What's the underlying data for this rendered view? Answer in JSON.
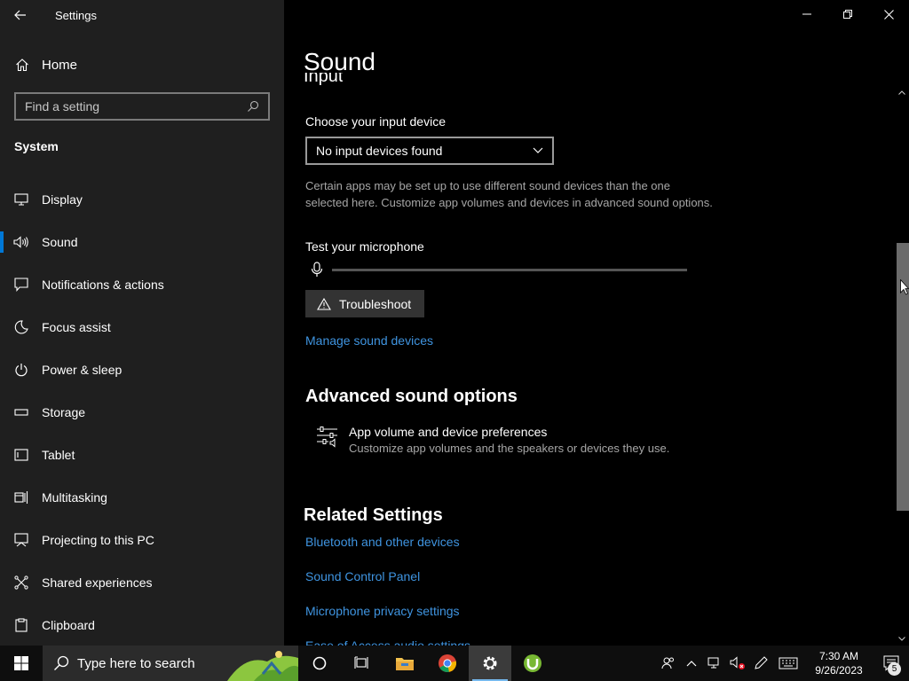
{
  "window": {
    "title": "Settings"
  },
  "nav": {
    "home_label": "Home",
    "search_placeholder": "Find a setting",
    "section_label": "System",
    "items": [
      {
        "label": "Display",
        "icon": "display-icon"
      },
      {
        "label": "Sound",
        "icon": "speaker-icon",
        "selected": true
      },
      {
        "label": "Notifications & actions",
        "icon": "notification-icon"
      },
      {
        "label": "Focus assist",
        "icon": "moon-icon"
      },
      {
        "label": "Power & sleep",
        "icon": "power-icon"
      },
      {
        "label": "Storage",
        "icon": "storage-icon"
      },
      {
        "label": "Tablet",
        "icon": "tablet-icon"
      },
      {
        "label": "Multitasking",
        "icon": "multitasking-icon"
      },
      {
        "label": "Projecting to this PC",
        "icon": "projecting-icon"
      },
      {
        "label": "Shared experiences",
        "icon": "shared-experiences-icon"
      },
      {
        "label": "Clipboard",
        "icon": "clipboard-icon"
      }
    ]
  },
  "main": {
    "page_title": "Sound",
    "input_heading": "Input",
    "input_device_label": "Choose your input device",
    "input_device_value": "No input devices found",
    "description": "Certain apps may be set up to use different sound devices than the one selected here. Customize app volumes and devices in advanced sound options.",
    "test_mic_label": "Test your microphone",
    "mic_level": 0,
    "troubleshoot_label": "Troubleshoot",
    "manage_devices_link": "Manage sound devices",
    "advanced_heading": "Advanced sound options",
    "app_volume_title": "App volume and device preferences",
    "app_volume_desc": "Customize app volumes and the speakers or devices they use.",
    "related_heading": "Related Settings",
    "related_links": [
      "Bluetooth and other devices",
      "Sound Control Panel",
      "Microphone privacy settings",
      "Ease of Access audio settings"
    ]
  },
  "taskbar": {
    "search_placeholder": "Type here to search",
    "clock_time": "7:30 AM",
    "clock_date": "9/26/2023",
    "notification_count": "5"
  },
  "colors": {
    "accent": "#0078d7",
    "link": "#3f94e0",
    "nav_bg": "#1f1f1f",
    "content_bg": "#000000"
  }
}
